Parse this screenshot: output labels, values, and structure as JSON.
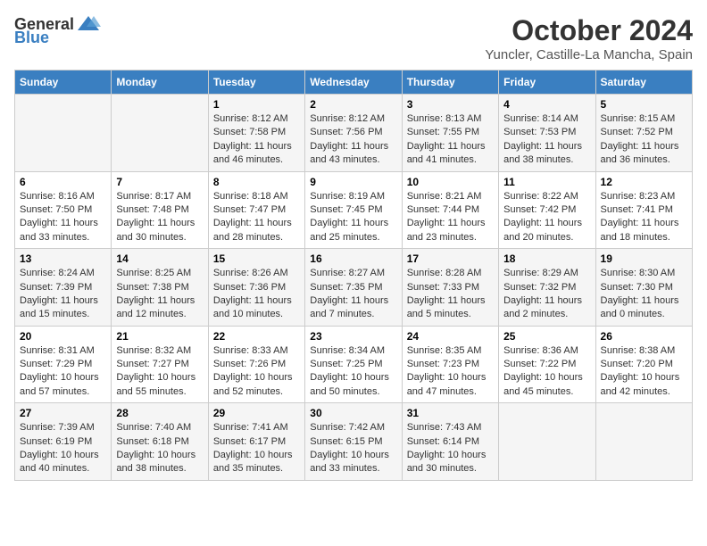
{
  "header": {
    "logo_general": "General",
    "logo_blue": "Blue",
    "month_title": "October 2024",
    "subtitle": "Yuncler, Castille-La Mancha, Spain"
  },
  "days_of_week": [
    "Sunday",
    "Monday",
    "Tuesday",
    "Wednesday",
    "Thursday",
    "Friday",
    "Saturday"
  ],
  "weeks": [
    [
      {
        "day": "",
        "content": ""
      },
      {
        "day": "",
        "content": ""
      },
      {
        "day": "1",
        "sunrise": "Sunrise: 8:12 AM",
        "sunset": "Sunset: 7:58 PM",
        "daylight": "Daylight: 11 hours and 46 minutes."
      },
      {
        "day": "2",
        "sunrise": "Sunrise: 8:12 AM",
        "sunset": "Sunset: 7:56 PM",
        "daylight": "Daylight: 11 hours and 43 minutes."
      },
      {
        "day": "3",
        "sunrise": "Sunrise: 8:13 AM",
        "sunset": "Sunset: 7:55 PM",
        "daylight": "Daylight: 11 hours and 41 minutes."
      },
      {
        "day": "4",
        "sunrise": "Sunrise: 8:14 AM",
        "sunset": "Sunset: 7:53 PM",
        "daylight": "Daylight: 11 hours and 38 minutes."
      },
      {
        "day": "5",
        "sunrise": "Sunrise: 8:15 AM",
        "sunset": "Sunset: 7:52 PM",
        "daylight": "Daylight: 11 hours and 36 minutes."
      }
    ],
    [
      {
        "day": "6",
        "sunrise": "Sunrise: 8:16 AM",
        "sunset": "Sunset: 7:50 PM",
        "daylight": "Daylight: 11 hours and 33 minutes."
      },
      {
        "day": "7",
        "sunrise": "Sunrise: 8:17 AM",
        "sunset": "Sunset: 7:48 PM",
        "daylight": "Daylight: 11 hours and 30 minutes."
      },
      {
        "day": "8",
        "sunrise": "Sunrise: 8:18 AM",
        "sunset": "Sunset: 7:47 PM",
        "daylight": "Daylight: 11 hours and 28 minutes."
      },
      {
        "day": "9",
        "sunrise": "Sunrise: 8:19 AM",
        "sunset": "Sunset: 7:45 PM",
        "daylight": "Daylight: 11 hours and 25 minutes."
      },
      {
        "day": "10",
        "sunrise": "Sunrise: 8:21 AM",
        "sunset": "Sunset: 7:44 PM",
        "daylight": "Daylight: 11 hours and 23 minutes."
      },
      {
        "day": "11",
        "sunrise": "Sunrise: 8:22 AM",
        "sunset": "Sunset: 7:42 PM",
        "daylight": "Daylight: 11 hours and 20 minutes."
      },
      {
        "day": "12",
        "sunrise": "Sunrise: 8:23 AM",
        "sunset": "Sunset: 7:41 PM",
        "daylight": "Daylight: 11 hours and 18 minutes."
      }
    ],
    [
      {
        "day": "13",
        "sunrise": "Sunrise: 8:24 AM",
        "sunset": "Sunset: 7:39 PM",
        "daylight": "Daylight: 11 hours and 15 minutes."
      },
      {
        "day": "14",
        "sunrise": "Sunrise: 8:25 AM",
        "sunset": "Sunset: 7:38 PM",
        "daylight": "Daylight: 11 hours and 12 minutes."
      },
      {
        "day": "15",
        "sunrise": "Sunrise: 8:26 AM",
        "sunset": "Sunset: 7:36 PM",
        "daylight": "Daylight: 11 hours and 10 minutes."
      },
      {
        "day": "16",
        "sunrise": "Sunrise: 8:27 AM",
        "sunset": "Sunset: 7:35 PM",
        "daylight": "Daylight: 11 hours and 7 minutes."
      },
      {
        "day": "17",
        "sunrise": "Sunrise: 8:28 AM",
        "sunset": "Sunset: 7:33 PM",
        "daylight": "Daylight: 11 hours and 5 minutes."
      },
      {
        "day": "18",
        "sunrise": "Sunrise: 8:29 AM",
        "sunset": "Sunset: 7:32 PM",
        "daylight": "Daylight: 11 hours and 2 minutes."
      },
      {
        "day": "19",
        "sunrise": "Sunrise: 8:30 AM",
        "sunset": "Sunset: 7:30 PM",
        "daylight": "Daylight: 11 hours and 0 minutes."
      }
    ],
    [
      {
        "day": "20",
        "sunrise": "Sunrise: 8:31 AM",
        "sunset": "Sunset: 7:29 PM",
        "daylight": "Daylight: 10 hours and 57 minutes."
      },
      {
        "day": "21",
        "sunrise": "Sunrise: 8:32 AM",
        "sunset": "Sunset: 7:27 PM",
        "daylight": "Daylight: 10 hours and 55 minutes."
      },
      {
        "day": "22",
        "sunrise": "Sunrise: 8:33 AM",
        "sunset": "Sunset: 7:26 PM",
        "daylight": "Daylight: 10 hours and 52 minutes."
      },
      {
        "day": "23",
        "sunrise": "Sunrise: 8:34 AM",
        "sunset": "Sunset: 7:25 PM",
        "daylight": "Daylight: 10 hours and 50 minutes."
      },
      {
        "day": "24",
        "sunrise": "Sunrise: 8:35 AM",
        "sunset": "Sunset: 7:23 PM",
        "daylight": "Daylight: 10 hours and 47 minutes."
      },
      {
        "day": "25",
        "sunrise": "Sunrise: 8:36 AM",
        "sunset": "Sunset: 7:22 PM",
        "daylight": "Daylight: 10 hours and 45 minutes."
      },
      {
        "day": "26",
        "sunrise": "Sunrise: 8:38 AM",
        "sunset": "Sunset: 7:20 PM",
        "daylight": "Daylight: 10 hours and 42 minutes."
      }
    ],
    [
      {
        "day": "27",
        "sunrise": "Sunrise: 7:39 AM",
        "sunset": "Sunset: 6:19 PM",
        "daylight": "Daylight: 10 hours and 40 minutes."
      },
      {
        "day": "28",
        "sunrise": "Sunrise: 7:40 AM",
        "sunset": "Sunset: 6:18 PM",
        "daylight": "Daylight: 10 hours and 38 minutes."
      },
      {
        "day": "29",
        "sunrise": "Sunrise: 7:41 AM",
        "sunset": "Sunset: 6:17 PM",
        "daylight": "Daylight: 10 hours and 35 minutes."
      },
      {
        "day": "30",
        "sunrise": "Sunrise: 7:42 AM",
        "sunset": "Sunset: 6:15 PM",
        "daylight": "Daylight: 10 hours and 33 minutes."
      },
      {
        "day": "31",
        "sunrise": "Sunrise: 7:43 AM",
        "sunset": "Sunset: 6:14 PM",
        "daylight": "Daylight: 10 hours and 30 minutes."
      },
      {
        "day": "",
        "content": ""
      },
      {
        "day": "",
        "content": ""
      }
    ]
  ]
}
